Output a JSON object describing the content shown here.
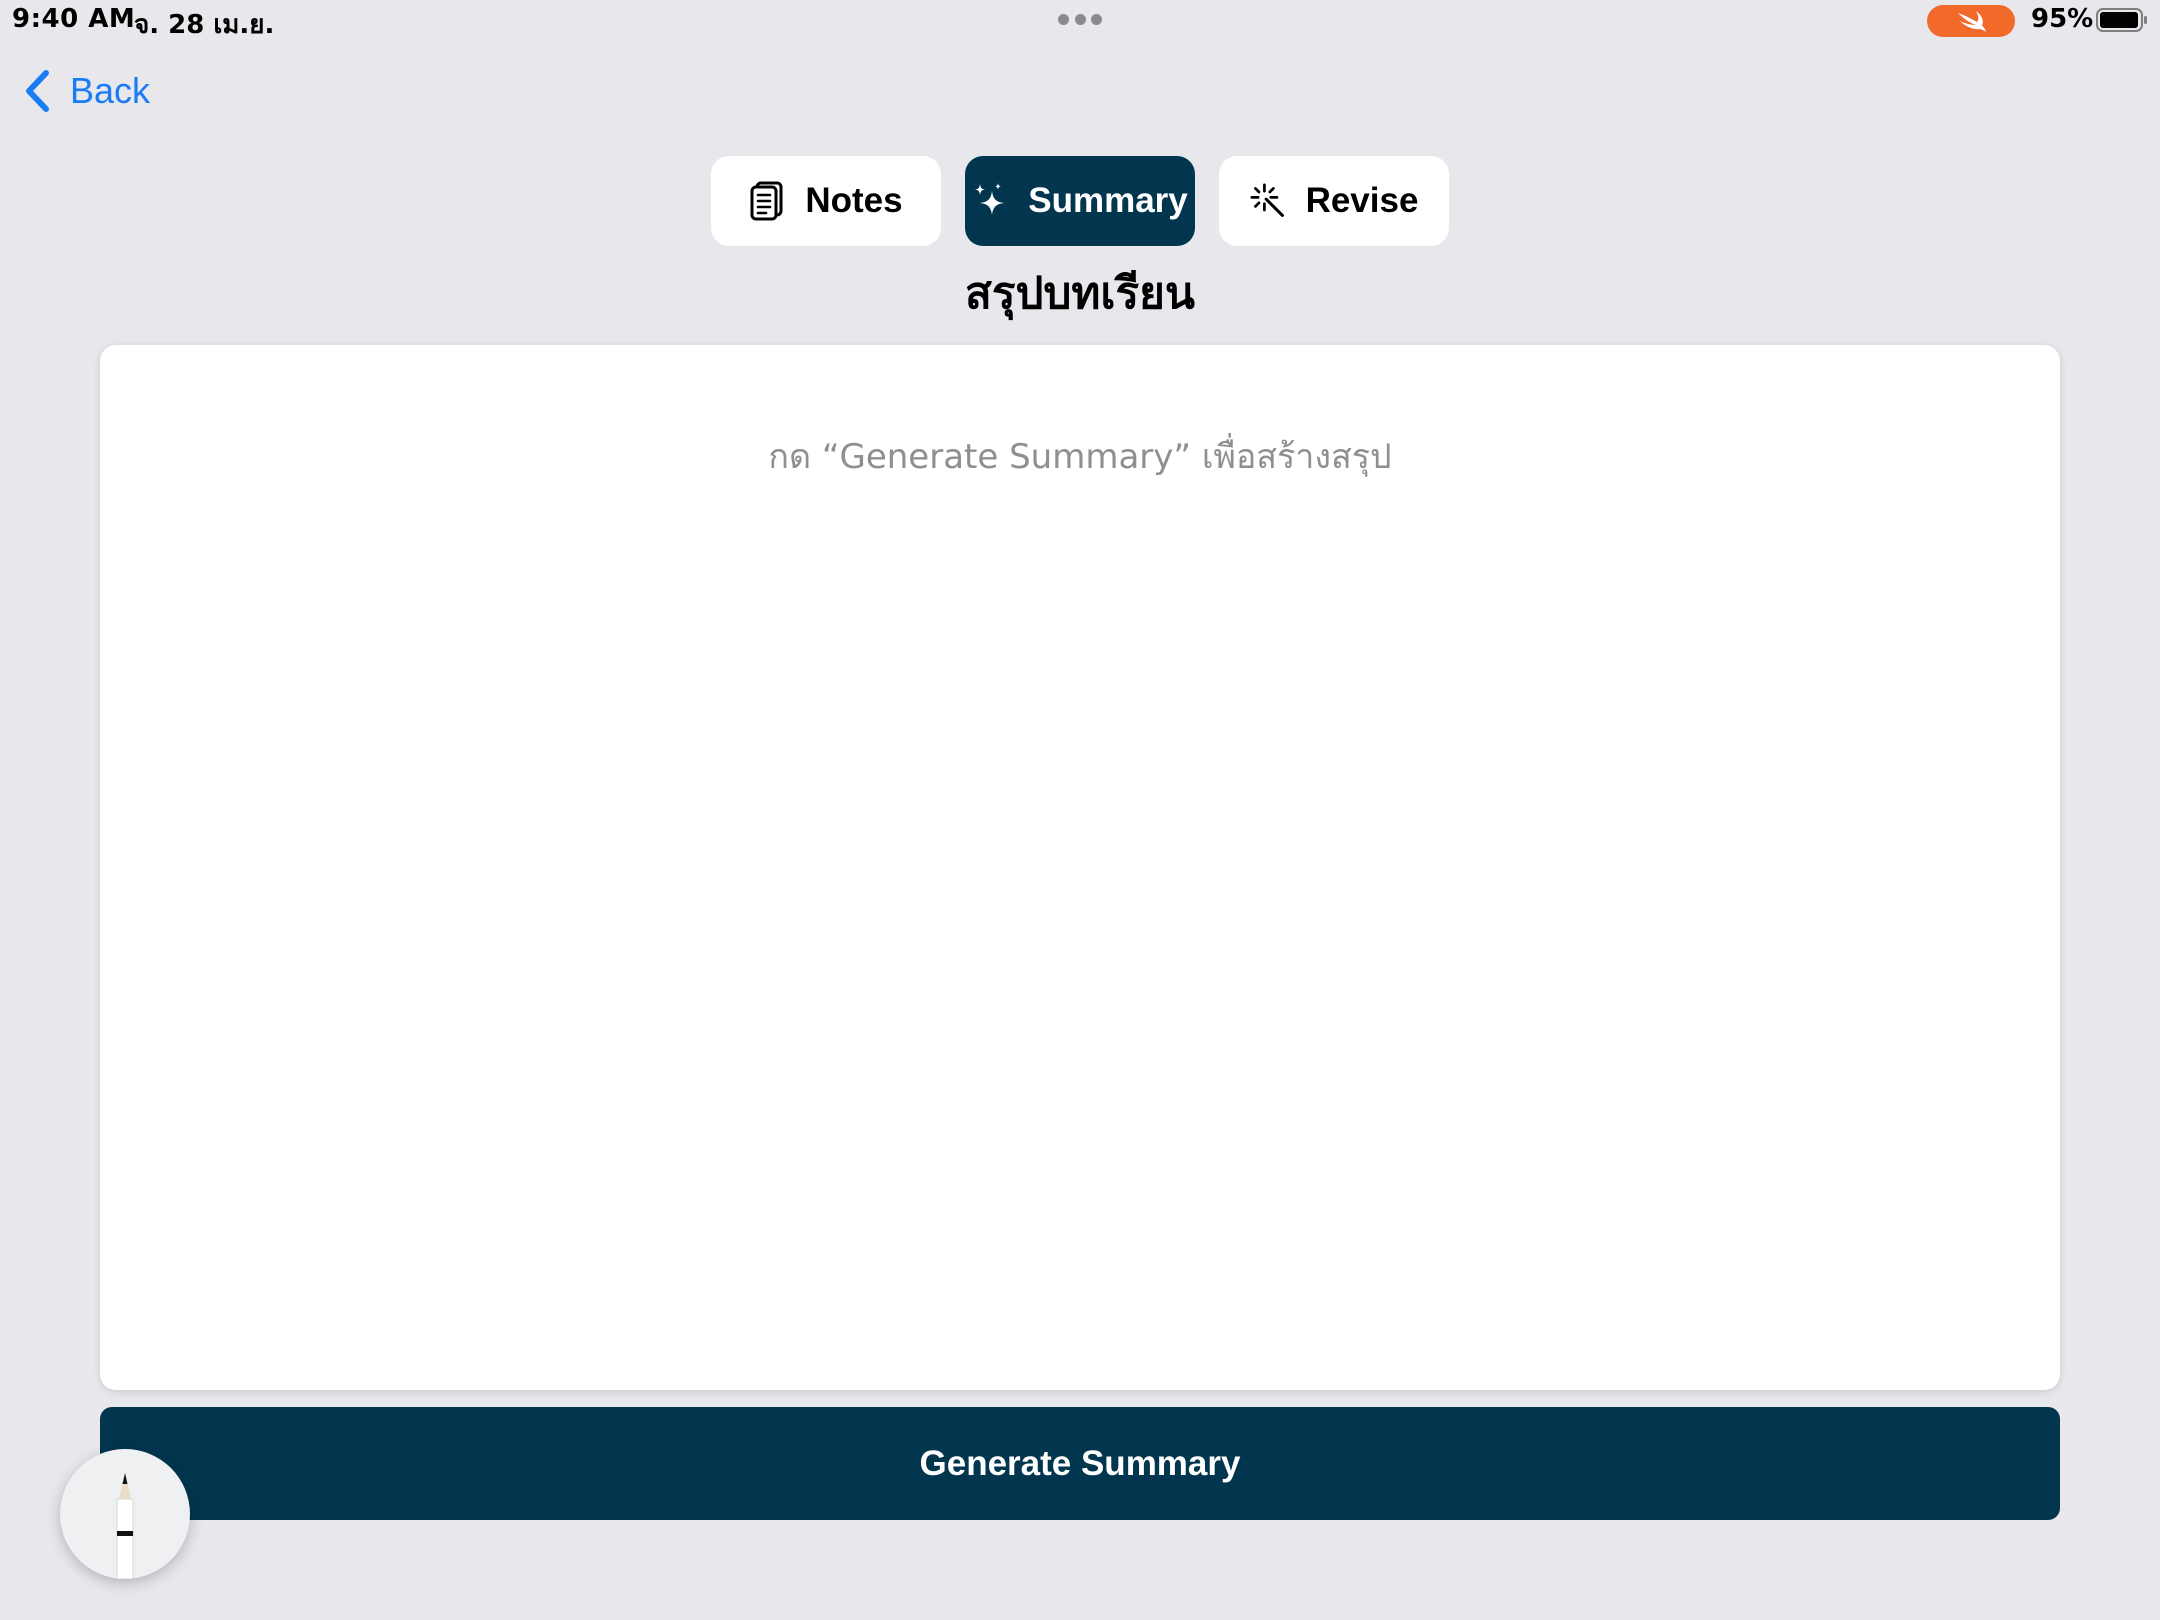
{
  "status_bar": {
    "time": "9:40 AM",
    "date": "จ. 28 เม.ย.",
    "battery_percent": "95%",
    "battery_level": 0.95,
    "swift_badge_color": "#f26a2a"
  },
  "nav": {
    "back_label": "Back",
    "back_icon": "chevron-left-icon"
  },
  "tabs": [
    {
      "label": "Notes",
      "icon": "notes-document-icon",
      "active": false
    },
    {
      "label": "Summary",
      "icon": "sparkles-icon",
      "active": true
    },
    {
      "label": "Revise",
      "icon": "magic-wand-icon",
      "active": false
    }
  ],
  "page": {
    "title": "สรุปบทเรียน"
  },
  "summary": {
    "placeholder": "กด “Generate Summary” เพื่อสร้างสรุป"
  },
  "actions": {
    "generate_label": "Generate Summary"
  },
  "tools": {
    "pencil_icon": "pencil-icon"
  },
  "colors": {
    "accent_dark": "#02364f",
    "link_blue": "#1a7cf5",
    "background": "#e7e7ec"
  }
}
